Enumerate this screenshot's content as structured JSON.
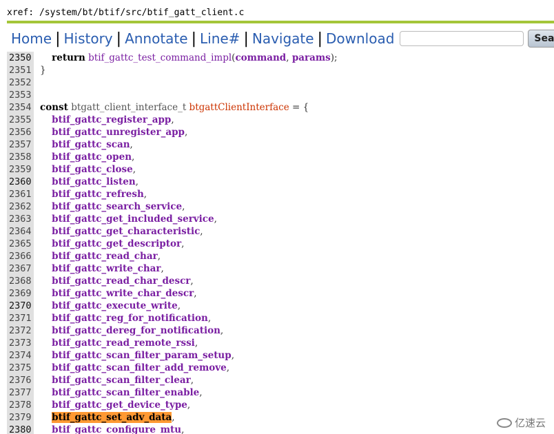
{
  "xref": "xref: /system/bt/btif/src/btif_gatt_client.c",
  "nav": {
    "items": [
      "Home",
      "History",
      "Annotate",
      "Line#",
      "Navigate",
      "Download"
    ],
    "search_value": "",
    "search_button": "Search"
  },
  "lines": [
    {
      "n": "2350",
      "indent": "    ",
      "parts": [
        [
          "kw",
          "return"
        ],
        [
          "plain",
          " "
        ],
        [
          "id",
          "btif_gattc_test_command_impl"
        ],
        [
          "plain",
          "("
        ],
        [
          "fn",
          "command"
        ],
        [
          "plain",
          ", "
        ],
        [
          "fn",
          "params"
        ],
        [
          "plain",
          ");"
        ]
      ]
    },
    {
      "n": "2351",
      "indent": "",
      "parts": [
        [
          "plain",
          "}"
        ]
      ]
    },
    {
      "n": "2352",
      "indent": "",
      "parts": []
    },
    {
      "n": "2353",
      "indent": "",
      "parts": []
    },
    {
      "n": "2354",
      "indent": "",
      "parts": [
        [
          "kw",
          "const"
        ],
        [
          "plain",
          " "
        ],
        [
          "ty",
          "btgatt_client_interface_t"
        ],
        [
          "plain",
          " "
        ],
        [
          "decl",
          "btgattClientInterface"
        ],
        [
          "plain",
          " = {"
        ]
      ]
    },
    {
      "n": "2355",
      "indent": "    ",
      "parts": [
        [
          "fn",
          "btif_gattc_register_app"
        ],
        [
          "plain",
          ","
        ]
      ]
    },
    {
      "n": "2356",
      "indent": "    ",
      "parts": [
        [
          "fn",
          "btif_gattc_unregister_app"
        ],
        [
          "plain",
          ","
        ]
      ]
    },
    {
      "n": "2357",
      "indent": "    ",
      "parts": [
        [
          "fn",
          "btif_gattc_scan"
        ],
        [
          "plain",
          ","
        ]
      ]
    },
    {
      "n": "2358",
      "indent": "    ",
      "parts": [
        [
          "fn",
          "btif_gattc_open"
        ],
        [
          "plain",
          ","
        ]
      ]
    },
    {
      "n": "2359",
      "indent": "    ",
      "parts": [
        [
          "fn",
          "btif_gattc_close"
        ],
        [
          "plain",
          ","
        ]
      ]
    },
    {
      "n": "2360",
      "indent": "    ",
      "parts": [
        [
          "fn",
          "btif_gattc_listen"
        ],
        [
          "plain",
          ","
        ]
      ]
    },
    {
      "n": "2361",
      "indent": "    ",
      "parts": [
        [
          "fn",
          "btif_gattc_refresh"
        ],
        [
          "plain",
          ","
        ]
      ]
    },
    {
      "n": "2362",
      "indent": "    ",
      "parts": [
        [
          "fn",
          "btif_gattc_search_service"
        ],
        [
          "plain",
          ","
        ]
      ]
    },
    {
      "n": "2363",
      "indent": "    ",
      "parts": [
        [
          "fn",
          "btif_gattc_get_included_service"
        ],
        [
          "plain",
          ","
        ]
      ]
    },
    {
      "n": "2364",
      "indent": "    ",
      "parts": [
        [
          "fn",
          "btif_gattc_get_characteristic"
        ],
        [
          "plain",
          ","
        ]
      ]
    },
    {
      "n": "2365",
      "indent": "    ",
      "parts": [
        [
          "fn",
          "btif_gattc_get_descriptor"
        ],
        [
          "plain",
          ","
        ]
      ]
    },
    {
      "n": "2366",
      "indent": "    ",
      "parts": [
        [
          "fn",
          "btif_gattc_read_char"
        ],
        [
          "plain",
          ","
        ]
      ]
    },
    {
      "n": "2367",
      "indent": "    ",
      "parts": [
        [
          "fn",
          "btif_gattc_write_char"
        ],
        [
          "plain",
          ","
        ]
      ]
    },
    {
      "n": "2368",
      "indent": "    ",
      "parts": [
        [
          "fn",
          "btif_gattc_read_char_descr"
        ],
        [
          "plain",
          ","
        ]
      ]
    },
    {
      "n": "2369",
      "indent": "    ",
      "parts": [
        [
          "fn",
          "btif_gattc_write_char_descr"
        ],
        [
          "plain",
          ","
        ]
      ]
    },
    {
      "n": "2370",
      "indent": "    ",
      "parts": [
        [
          "fn",
          "btif_gattc_execute_write"
        ],
        [
          "plain",
          ","
        ]
      ]
    },
    {
      "n": "2371",
      "indent": "    ",
      "parts": [
        [
          "fn",
          "btif_gattc_reg_for_notification"
        ],
        [
          "plain",
          ","
        ]
      ]
    },
    {
      "n": "2372",
      "indent": "    ",
      "parts": [
        [
          "fn",
          "btif_gattc_dereg_for_notification"
        ],
        [
          "plain",
          ","
        ]
      ]
    },
    {
      "n": "2373",
      "indent": "    ",
      "parts": [
        [
          "fn",
          "btif_gattc_read_remote_rssi"
        ],
        [
          "plain",
          ","
        ]
      ]
    },
    {
      "n": "2374",
      "indent": "    ",
      "parts": [
        [
          "fn",
          "btif_gattc_scan_filter_param_setup"
        ],
        [
          "plain",
          ","
        ]
      ]
    },
    {
      "n": "2375",
      "indent": "    ",
      "parts": [
        [
          "fn",
          "btif_gattc_scan_filter_add_remove"
        ],
        [
          "plain",
          ","
        ]
      ]
    },
    {
      "n": "2376",
      "indent": "    ",
      "parts": [
        [
          "fn",
          "btif_gattc_scan_filter_clear"
        ],
        [
          "plain",
          ","
        ]
      ]
    },
    {
      "n": "2377",
      "indent": "    ",
      "parts": [
        [
          "fn",
          "btif_gattc_scan_filter_enable"
        ],
        [
          "plain",
          ","
        ]
      ]
    },
    {
      "n": "2378",
      "indent": "    ",
      "parts": [
        [
          "fn",
          "btif_gattc_get_device_type"
        ],
        [
          "plain",
          ","
        ]
      ]
    },
    {
      "n": "2379",
      "indent": "    ",
      "parts": [
        [
          "hit",
          "btif_gattc_set_adv_data"
        ],
        [
          "plain",
          ","
        ]
      ]
    },
    {
      "n": "2380",
      "indent": "    ",
      "parts": [
        [
          "fn",
          "btif_gattc_configure_mtu"
        ],
        [
          "plain",
          ","
        ]
      ]
    }
  ],
  "highlight_line_numbers": [
    "2350",
    "2360",
    "2370",
    "2380"
  ],
  "watermark": "亿速云",
  "colors": {
    "accent_bar": "#a4c639",
    "nav_link": "#2a5db0",
    "identifier": "#7a1fa2",
    "declaration": "#cc3300",
    "search_hit": "#ff9933",
    "line_number_bg": "#e0e0e0"
  }
}
